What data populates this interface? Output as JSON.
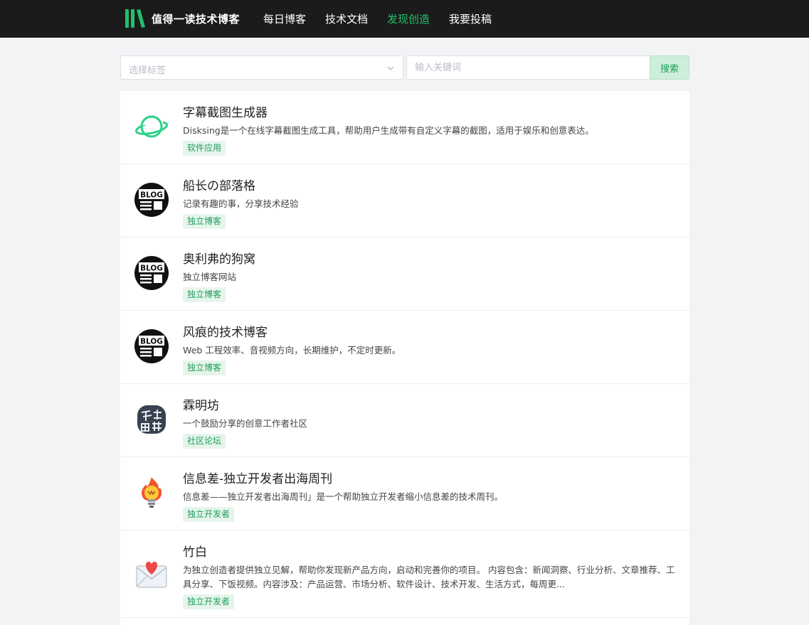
{
  "header": {
    "brand_name": "值得一读技术博客",
    "brand_logo_icon": "books-logo-icon",
    "nav": [
      {
        "label": "每日博客",
        "active": false
      },
      {
        "label": "技术文档",
        "active": false
      },
      {
        "label": "发现创造",
        "active": true
      },
      {
        "label": "我要投稿",
        "active": false
      }
    ]
  },
  "filters": {
    "tag_placeholder": "选择标签",
    "keyword_placeholder": "输入关键词",
    "search_label": "搜索"
  },
  "colors": {
    "accent": "#22c06e",
    "header_bg": "#1b1b1b",
    "tag_bg": "#e6f5ec",
    "tag_text": "#1f9e5b"
  },
  "items": [
    {
      "title": "字幕截图生成器",
      "desc": "Disksing是一个在线字幕截图生成工具，帮助用户生成带有自定义字幕的截图，适用于娱乐和创意表达。",
      "tag": "软件应用",
      "icon": "planet-icon"
    },
    {
      "title": "船长の部落格",
      "desc": "记录有趣的事，分享技术经验",
      "tag": "独立博客",
      "icon": "blog-icon"
    },
    {
      "title": "奥利弗的狗窝",
      "desc": "独立博客网站",
      "tag": "独立博客",
      "icon": "blog-icon"
    },
    {
      "title": "风痕的技术博客",
      "desc": "Web 工程效率、音视频方向，长期维护，不定时更新。",
      "tag": "独立博客",
      "icon": "blog-icon"
    },
    {
      "title": "霖明坊",
      "desc": "一个鼓励分享的创意工作者社区",
      "tag": "社区论坛",
      "icon": "stamp-logo-icon"
    },
    {
      "title": "信息差-独立开发者出海周刊",
      "desc": "信息差——独立开发者出海周刊」是一个帮助独立开发者缩小信息差的技术周刊。",
      "tag": "独立开发者",
      "icon": "lightbulb-icon"
    },
    {
      "title": "竹白",
      "desc": "为独立创造者提供独立见解，帮助你发现新产品方向，启动和完善你的项目。 内容包含：新闻洞察、行业分析、文章推荐、工具分享、下饭视频。内容涉及：产品运营、市场分析、软件设计、技术开发、生活方式，每周更...",
      "tag": "独立开发者",
      "icon": "heart-envelope-icon"
    }
  ]
}
